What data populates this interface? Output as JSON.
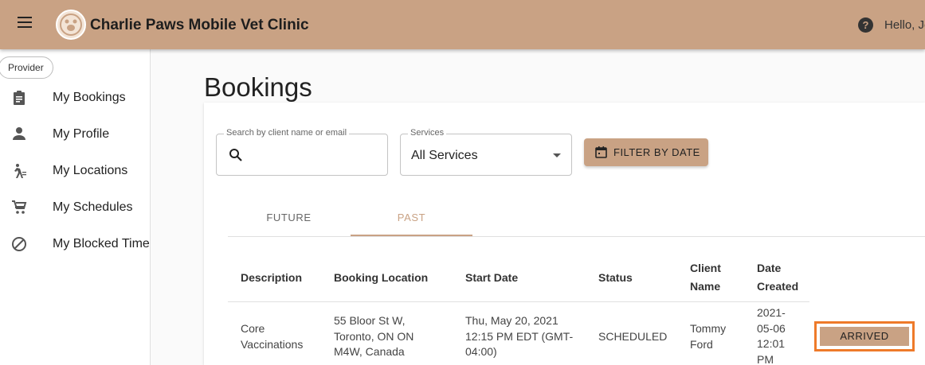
{
  "header": {
    "title": "Charlie Paws Mobile Vet Clinic",
    "greeting": "Hello, Jo"
  },
  "sidebar": {
    "role": "Provider",
    "items": [
      {
        "label": "My Bookings",
        "icon": "clipboard-icon"
      },
      {
        "label": "My Profile",
        "icon": "person-icon"
      },
      {
        "label": "My Locations",
        "icon": "walking-icon"
      },
      {
        "label": "My Schedules",
        "icon": "cart-icon"
      },
      {
        "label": "My Blocked Times",
        "icon": "block-icon"
      }
    ]
  },
  "page": {
    "title": "Bookings"
  },
  "filters": {
    "search_legend": "Search by client name or email",
    "services_legend": "Services",
    "services_value": "All Services",
    "filter_button": "FILTER BY DATE"
  },
  "tabs": [
    {
      "label": "FUTURE"
    },
    {
      "label": "PAST"
    }
  ],
  "table": {
    "headers": {
      "description": "Description",
      "location": "Booking Location",
      "start": "Start Date",
      "status": "Status",
      "client_l1": "Client",
      "client_l2": "Name",
      "created_l1": "Date",
      "created_l2": "Created"
    },
    "rows": [
      {
        "description": [
          "Core",
          "Vaccinations"
        ],
        "location": [
          "55 Bloor St W,",
          "Toronto, ON ON",
          "M4W, Canada"
        ],
        "start": [
          "Thu, May 20, 2021",
          "12:15 PM EDT (GMT-",
          "04:00)"
        ],
        "status": "SCHEDULED",
        "client": [
          "Tommy",
          "Ford"
        ],
        "created": [
          "2021-",
          "05-06",
          "12:01",
          "PM"
        ],
        "action": "ARRIVED"
      }
    ]
  },
  "colors": {
    "brand": "#c9a284",
    "highlight": "#ee7a2a"
  }
}
